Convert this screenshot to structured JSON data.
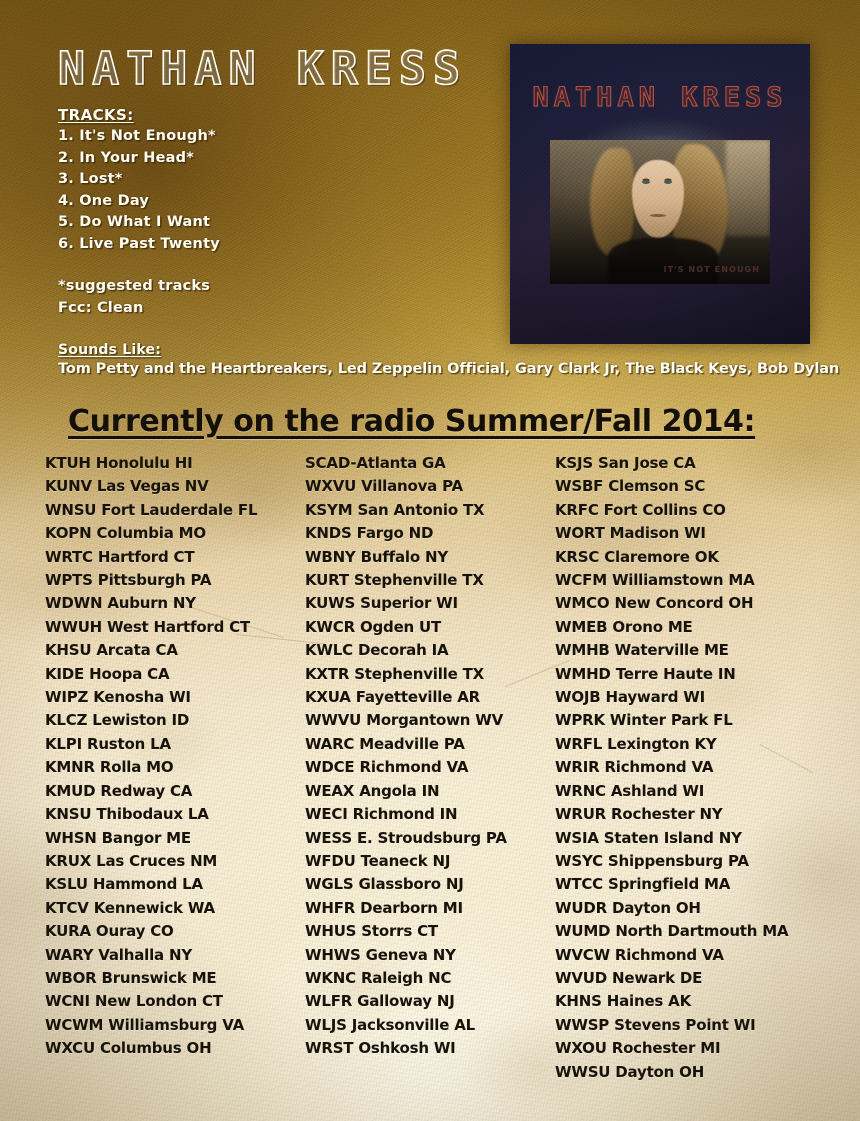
{
  "artist": {
    "name": "NATHAN  KRESS"
  },
  "tracks_section": {
    "label": "TRACKS:",
    "items": [
      "1. It's Not Enough*",
      "2. In Your Head*",
      "3. Lost*",
      "4. One Day",
      "5. Do What I Want",
      "6. Live Past Twenty"
    ]
  },
  "notes": {
    "suggested": "*suggested tracks",
    "fcc": "Fcc: Clean"
  },
  "sounds_like": {
    "label": "Sounds Like:",
    "value": "Tom Petty and the Heartbreakers, Led Zeppelin Official, Gary Clark Jr, The Black Keys, Bob Dylan"
  },
  "album_art": {
    "title": "NATHAN KRESS",
    "caption": "IT'S NOT ENOUGH"
  },
  "radio": {
    "heading": "Currently on the radio Summer/Fall 2014:",
    "columns": [
      {
        "stations": [
          "KTUH Honolulu HI",
          "KUNV Las Vegas NV",
          "WNSU Fort Lauderdale FL",
          "KOPN Columbia MO",
          "WRTC Hartford CT",
          "WPTS Pittsburgh PA",
          "WDWN Auburn NY",
          "WWUH West Hartford CT",
          "KHSU Arcata CA",
          "KIDE Hoopa CA",
          "WIPZ Kenosha WI",
          "KLCZ Lewiston ID",
          "KLPI Ruston LA",
          "KMNR Rolla MO",
          "KMUD Redway CA",
          "KNSU Thibodaux LA",
          "WHSN Bangor ME",
          "KRUX Las Cruces NM",
          "KSLU Hammond LA",
          "KTCV Kennewick WA",
          "KURA Ouray CO",
          "WARY Valhalla NY",
          "WBOR Brunswick ME",
          "WCNI New London CT",
          "WCWM Williamsburg VA",
          "WXCU Columbus OH"
        ]
      },
      {
        "stations": [
          "SCAD-Atlanta GA",
          "WXVU Villanova PA",
          "KSYM San Antonio TX",
          "KNDS Fargo ND",
          "WBNY Buffalo NY",
          "KURT Stephenville TX",
          "KUWS Superior WI",
          "KWCR Ogden UT",
          "KWLC Decorah IA",
          "KXTR Stephenville TX",
          "KXUA Fayetteville AR",
          "WWVU Morgantown WV",
          "WARC Meadville PA",
          "WDCE Richmond VA",
          "WEAX Angola IN",
          "WECI Richmond IN",
          "WESS E. Stroudsburg PA",
          "WFDU Teaneck NJ",
          "WGLS Glassboro NJ",
          "WHFR Dearborn MI",
          "WHUS Storrs CT",
          "WHWS Geneva NY",
          "WKNC Raleigh NC",
          "WLFR Galloway NJ",
          "WLJS Jacksonville AL",
          "WRST Oshkosh WI"
        ]
      },
      {
        "stations": [
          "KSJS San Jose CA",
          "WSBF Clemson SC",
          "KRFC Fort Collins CO",
          "WORT Madison WI",
          "KRSC Claremore OK",
          "WCFM Williamstown MA",
          "WMCO New Concord OH",
          "WMEB Orono ME",
          "WMHB Waterville ME",
          "WMHD Terre Haute IN",
          "WOJB Hayward WI",
          "WPRK Winter Park FL",
          "WRFL Lexington KY",
          "WRIR Richmond VA",
          "WRNC Ashland WI",
          "WRUR Rochester NY",
          "WSIA Staten Island NY",
          "WSYC Shippensburg PA",
          "WTCC Springfield MA",
          "WUDR Dayton OH",
          "WUMD North Dartmouth MA",
          "WVCW Richmond VA",
          "WVUD Newark DE",
          "KHNS Haines AK",
          "WWSP Stevens Point WI",
          "WXOU Rochester MI",
          "WWSU Dayton OH"
        ]
      }
    ]
  },
  "colors": {
    "paper_dark": "#8a6a1f",
    "paper_light": "#f4e9d2",
    "text_dark": "#17120a",
    "text_light": "#fffdf2",
    "album_bg": "#1b1c36",
    "album_accent": "#b5513c"
  }
}
